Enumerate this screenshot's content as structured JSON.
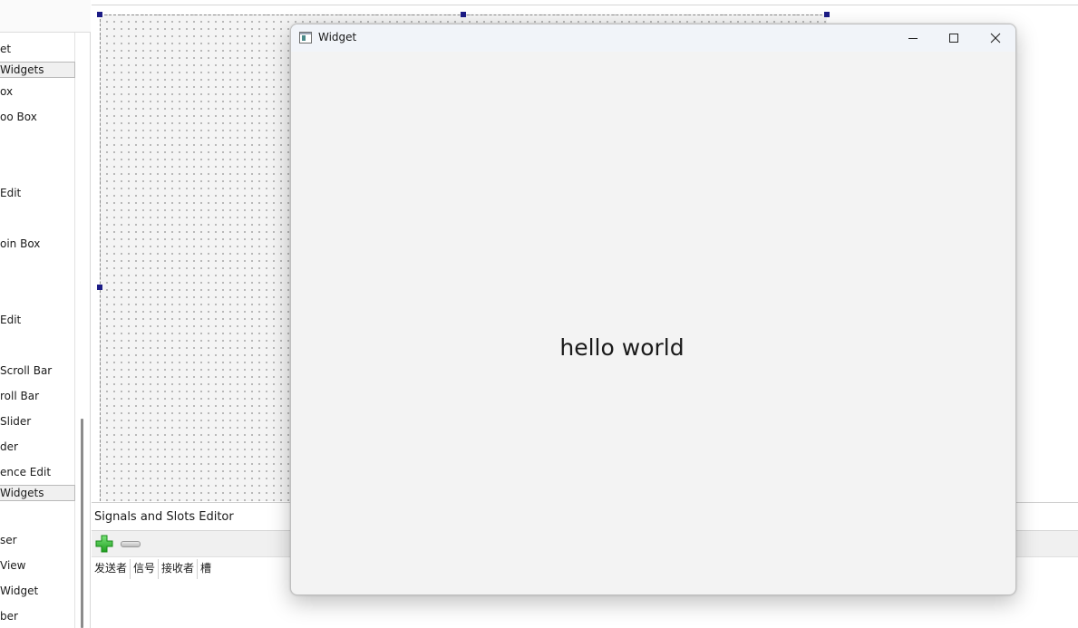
{
  "widget_box": {
    "items": [
      {
        "label": "et",
        "type": "item"
      },
      {
        "label": "Widgets",
        "type": "category"
      },
      {
        "label": "ox",
        "type": "item"
      },
      {
        "label": "oo Box",
        "type": "item"
      },
      {
        "label": "Edit",
        "type": "item"
      },
      {
        "label": "oin Box",
        "type": "item"
      },
      {
        "label": " Edit",
        "type": "item"
      },
      {
        "label": " Scroll Bar",
        "type": "item"
      },
      {
        "label": "roll Bar",
        "type": "item"
      },
      {
        "label": " Slider",
        "type": "item"
      },
      {
        "label": "der",
        "type": "item"
      },
      {
        "label": "ence Edit",
        "type": "item"
      },
      {
        "label": " Widgets",
        "type": "category"
      },
      {
        "label": "ser",
        "type": "item"
      },
      {
        "label": "View",
        "type": "item"
      },
      {
        "label": "Widget",
        "type": "item"
      },
      {
        "label": "ber",
        "type": "item"
      }
    ]
  },
  "signals_editor": {
    "title": "Signals and Slots Editor",
    "add_icon": "plus-icon",
    "remove_icon": "minus-icon",
    "columns": [
      "发送者",
      "信号",
      "接收者",
      "槽"
    ]
  },
  "widget_window": {
    "title": "Widget",
    "label_text": "hello world",
    "controls": [
      "minimize-icon",
      "maximize-icon",
      "close-icon"
    ]
  },
  "colors": {
    "selection_handle": "#1c1c86",
    "window_background": "#f3f3f3",
    "add_icon_green": "#2fbf2f"
  }
}
